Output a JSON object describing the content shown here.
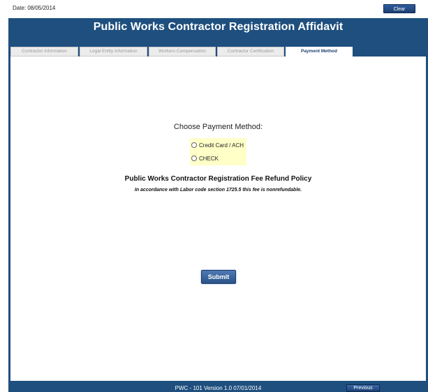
{
  "header": {
    "date_text": "Date: 08/05/2014",
    "clear_label": "Clear",
    "title": "Public Works Contractor Registration Affidavit"
  },
  "tabs": [
    {
      "label": "Contractor Information",
      "active": false
    },
    {
      "label": "Legal Entity Information",
      "active": false
    },
    {
      "label": "Workers Compensation",
      "active": false
    },
    {
      "label": "Contractor Certification",
      "active": false
    },
    {
      "label": "Payment Method",
      "active": true
    }
  ],
  "payment": {
    "prompt": "Choose Payment Method:",
    "options": [
      {
        "label": "Credit Card / ACH",
        "selected": false
      },
      {
        "label": "CHECK",
        "selected": false
      }
    ]
  },
  "policy": {
    "title": "Public Works Contractor Registration Fee Refund Policy",
    "text": "In accordance with Labor code section 1725.5 this fee is nonrefundable."
  },
  "submit_label": "Submit",
  "footer": {
    "version_text": "PWC - 101 Version 1.0 07/01/2014",
    "previous_label": "Previous"
  },
  "colors": {
    "frame": "#1e4f7e",
    "payment_box": "#ffffc8",
    "button": "#2a5389"
  }
}
